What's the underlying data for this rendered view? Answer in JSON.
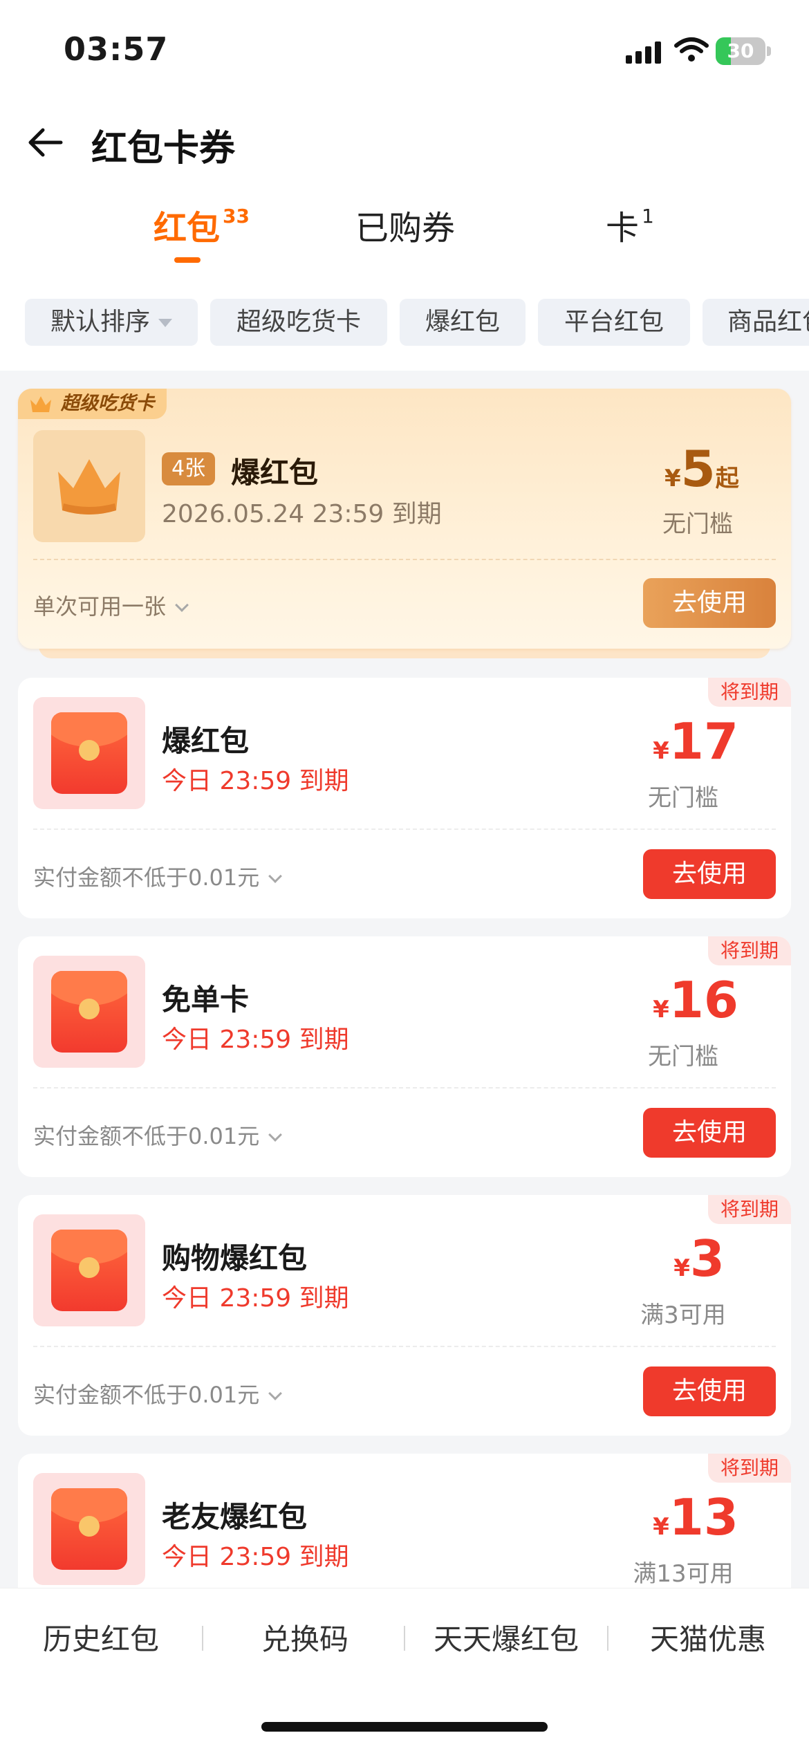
{
  "status_bar": {
    "time": "03:57",
    "battery": "30",
    "battery_level": 0.3
  },
  "header": {
    "title": "红包卡券"
  },
  "tabs": [
    {
      "label": "红包",
      "count": "33"
    },
    {
      "label": "已购券",
      "count": ""
    },
    {
      "label": "卡",
      "count": "1"
    }
  ],
  "filters": [
    {
      "label": "默认排序"
    },
    {
      "label": "超级吃货卡"
    },
    {
      "label": "爆红包"
    },
    {
      "label": "平台红包"
    },
    {
      "label": "商品红包"
    }
  ],
  "featured": {
    "tag": "超级吃货卡",
    "count_badge": "4张",
    "name": "爆红包",
    "expiry": "2026.05.24 23:59 到期",
    "currency": "¥",
    "amount": "5",
    "amount_suffix": "起",
    "condition": "无门槛",
    "note": "单次可用一张",
    "button": "去使用"
  },
  "cards": [
    {
      "expire_tag": "将到期",
      "name": "爆红包",
      "expiry": "今日 23:59 到期",
      "currency": "¥",
      "amount": "17",
      "condition": "无门槛",
      "note": "实付金额不低于0.01元",
      "button": "去使用"
    },
    {
      "expire_tag": "将到期",
      "name": "免单卡",
      "expiry": "今日 23:59 到期",
      "currency": "¥",
      "amount": "16",
      "condition": "无门槛",
      "note": "实付金额不低于0.01元",
      "button": "去使用"
    },
    {
      "expire_tag": "将到期",
      "name": "购物爆红包",
      "expiry": "今日 23:59 到期",
      "currency": "¥",
      "amount": "3",
      "condition": "满3可用",
      "note": "实付金额不低于0.01元",
      "button": "去使用"
    },
    {
      "expire_tag": "将到期",
      "name": "老友爆红包",
      "expiry": "今日 23:59 到期",
      "currency": "¥",
      "amount": "13",
      "condition": "满13可用",
      "note": "",
      "button": ""
    }
  ],
  "bottom_nav": [
    {
      "label": "历史红包"
    },
    {
      "label": "兑换码"
    },
    {
      "label": "天天爆红包"
    },
    {
      "label": "天猫优惠"
    }
  ],
  "colors": {
    "accent_orange": "#ff6a00",
    "red": "#ef3a2c",
    "gold": "#a85a10"
  }
}
